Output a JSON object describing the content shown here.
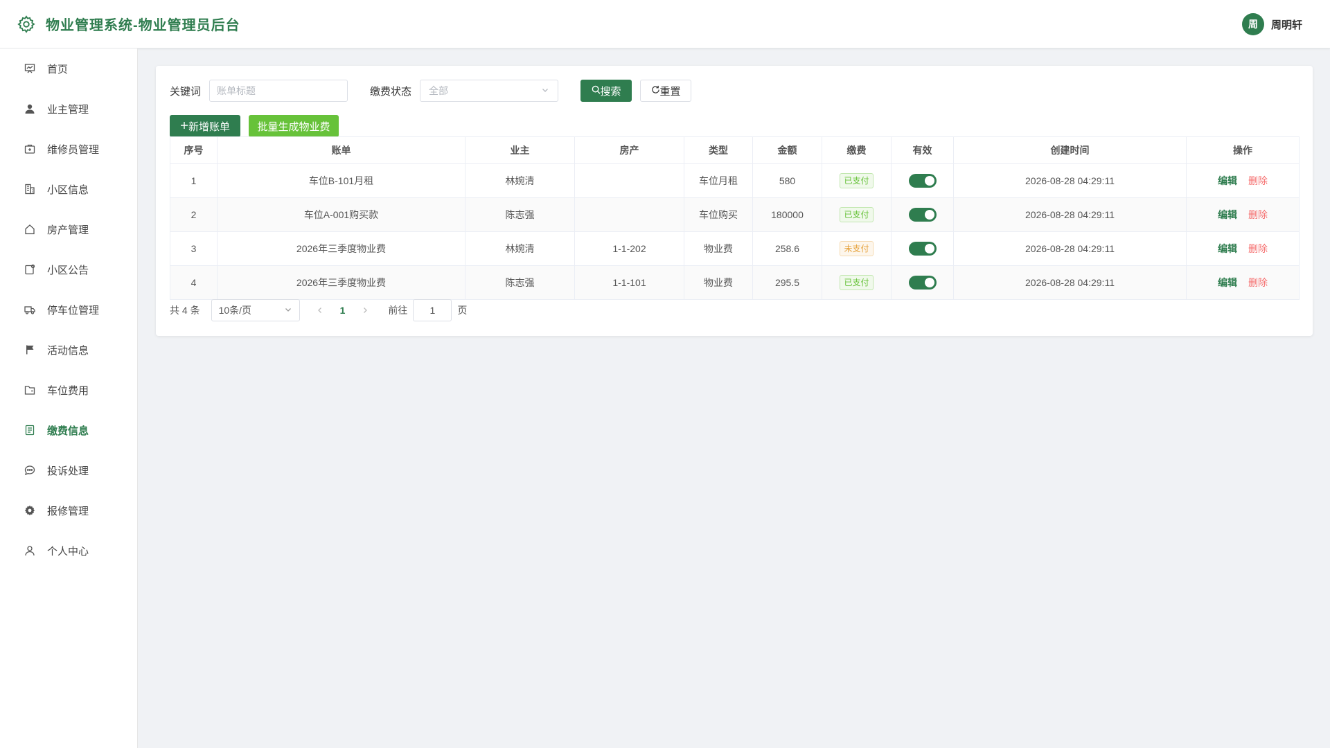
{
  "header": {
    "title": "物业管理系统-物业管理员后台",
    "user": {
      "avatar_text": "周",
      "name": "周明轩"
    }
  },
  "sidebar": {
    "items": [
      {
        "label": "首页",
        "icon": "dashboard-icon"
      },
      {
        "label": "业主管理",
        "icon": "user-icon"
      },
      {
        "label": "维修员管理",
        "icon": "toolbox-icon"
      },
      {
        "label": "小区信息",
        "icon": "building-icon"
      },
      {
        "label": "房产管理",
        "icon": "house-icon"
      },
      {
        "label": "小区公告",
        "icon": "notice-icon"
      },
      {
        "label": "停车位管理",
        "icon": "truck-icon"
      },
      {
        "label": "活动信息",
        "icon": "flag-icon"
      },
      {
        "label": "车位费用",
        "icon": "folder-icon"
      },
      {
        "label": "缴费信息",
        "icon": "document-icon",
        "active": true
      },
      {
        "label": "投诉处理",
        "icon": "chat-icon"
      },
      {
        "label": "报修管理",
        "icon": "gear-icon"
      },
      {
        "label": "个人中心",
        "icon": "person-icon"
      }
    ]
  },
  "filters": {
    "keyword_label": "关键词",
    "keyword_placeholder": "账单标题",
    "keyword_value": "",
    "status_label": "缴费状态",
    "status_value": "全部",
    "search_label": "搜索",
    "reset_label": "重置"
  },
  "actions": {
    "add_label": "新增账单",
    "batch_label": "批量生成物业费"
  },
  "table": {
    "columns": [
      "序号",
      "账单",
      "业主",
      "房产",
      "类型",
      "金额",
      "缴费",
      "有效",
      "创建时间",
      "操作"
    ],
    "rows": [
      {
        "index": "1",
        "bill": "车位B-101月租",
        "owner": "林婉清",
        "property": "",
        "type": "车位月租",
        "amount": "580",
        "status": "已支付",
        "valid": true,
        "created": "2026-08-28 04:29:11"
      },
      {
        "index": "2",
        "bill": "车位A-001购买款",
        "owner": "陈志强",
        "property": "",
        "type": "车位购买",
        "amount": "180000",
        "status": "已支付",
        "valid": true,
        "created": "2026-08-28 04:29:11"
      },
      {
        "index": "3",
        "bill": "2026年三季度物业费",
        "owner": "林婉清",
        "property": "1-1-202",
        "type": "物业费",
        "amount": "258.6",
        "status": "未支付",
        "valid": true,
        "created": "2026-08-28 04:29:11"
      },
      {
        "index": "4",
        "bill": "2026年三季度物业费",
        "owner": "陈志强",
        "property": "1-1-101",
        "type": "物业费",
        "amount": "295.5",
        "status": "已支付",
        "valid": true,
        "created": "2026-08-28 04:29:11"
      }
    ],
    "edit_label": "编辑",
    "delete_label": "删除"
  },
  "pagination": {
    "total_text": "共 4 条",
    "page_size": "10条/页",
    "current_page": "1",
    "goto_label": "前往",
    "goto_value": "1",
    "page_unit": "页"
  },
  "colors": {
    "primary": "#2f7d4f",
    "success": "#67c23a",
    "warning": "#e6a23c",
    "danger": "#f56c6c"
  }
}
